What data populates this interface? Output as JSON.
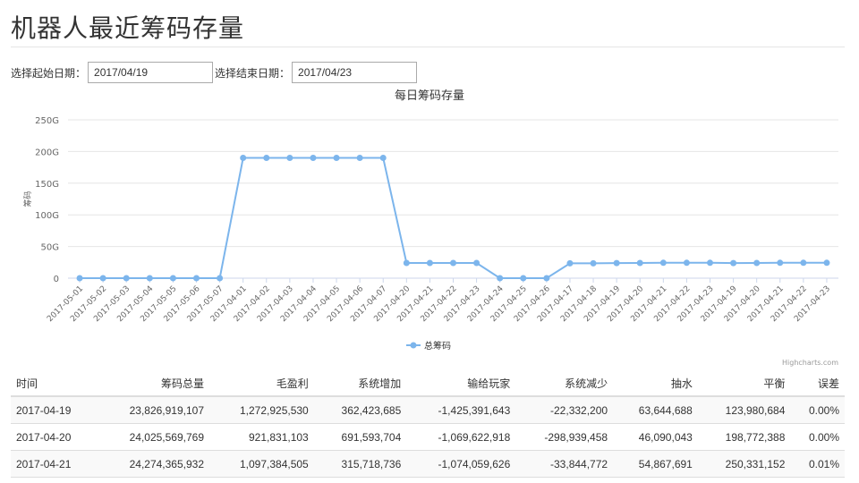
{
  "page": {
    "title": "机器人最近筹码存量"
  },
  "filters": {
    "start_label": "选择起始日期：",
    "start_value": "2017/04/19",
    "end_label": "选择结束日期：",
    "end_value": "2017/04/23"
  },
  "chart_data": {
    "type": "line",
    "title": "每日筹码存量",
    "ylabel": "筹码",
    "categories": [
      "2017-05-01",
      "2017-05-02",
      "2017-05-03",
      "2017-05-04",
      "2017-05-05",
      "2017-05-06",
      "2017-05-07",
      "2017-04-01",
      "2017-04-02",
      "2017-04-03",
      "2017-04-04",
      "2017-04-05",
      "2017-04-06",
      "2017-04-07",
      "2017-04-20",
      "2017-04-21",
      "2017-04-22",
      "2017-04-23",
      "2017-04-24",
      "2017-04-25",
      "2017-04-26",
      "2017-04-17",
      "2017-04-18",
      "2017-04-19",
      "2017-04-20",
      "2017-04-21",
      "2017-04-22",
      "2017-04-23",
      "2017-04-19",
      "2017-04-20",
      "2017-04-21",
      "2017-04-22",
      "2017-04-23"
    ],
    "y_ticks": [
      "0",
      "50G",
      "100G",
      "150G",
      "200G",
      "250G"
    ],
    "ylim": [
      0,
      250
    ],
    "grid": true,
    "legend_position": "bottom-center",
    "series": [
      {
        "name": "总筹码",
        "color": "#7cb5ec",
        "values": [
          0,
          0,
          0,
          0,
          0,
          0,
          0,
          190,
          190,
          190,
          190,
          190,
          190,
          190,
          24,
          24,
          24,
          24,
          0,
          0,
          0,
          23.5,
          23.5,
          23.8,
          24.0,
          24.3,
          24.3,
          24.3,
          23.8,
          24.0,
          24.3,
          24.3,
          24.3
        ]
      }
    ],
    "credit": "Highcharts.com"
  },
  "table": {
    "headers": [
      "时间",
      "筹码总量",
      "毛盈利",
      "系统增加",
      "输给玩家",
      "系统减少",
      "抽水",
      "平衡",
      "误差"
    ],
    "rows": [
      [
        "2017-04-19",
        "23,826,919,107",
        "1,272,925,530",
        "362,423,685",
        "-1,425,391,643",
        "-22,332,200",
        "63,644,688",
        "123,980,684",
        "0.00%"
      ],
      [
        "2017-04-20",
        "24,025,569,769",
        "921,831,103",
        "691,593,704",
        "-1,069,622,918",
        "-298,939,458",
        "46,090,043",
        "198,772,388",
        "0.00%"
      ],
      [
        "2017-04-21",
        "24,274,365,932",
        "1,097,384,505",
        "315,718,736",
        "-1,074,059,626",
        "-33,844,772",
        "54,867,691",
        "250,331,152",
        "0.01%"
      ]
    ]
  }
}
